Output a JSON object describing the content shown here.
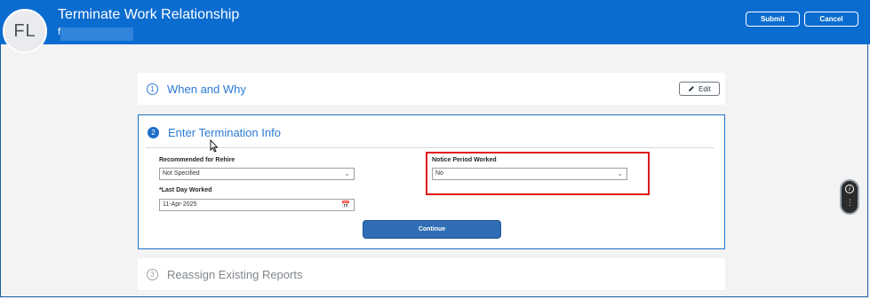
{
  "header": {
    "avatar_initials": "FL",
    "title": "Terminate Work Relationship",
    "subtitle": "f",
    "submit_label": "Submit",
    "cancel_label": "Cancel",
    "bg_color": "#0b6cd0"
  },
  "steps": [
    {
      "number": "1",
      "title": "When and Why",
      "edit_label": "Edit"
    },
    {
      "number": "2",
      "title": "Enter Termination Info"
    },
    {
      "number": "3",
      "title": "Reassign Existing Reports"
    }
  ],
  "form": {
    "rehire_label": "Recommended for Rehire",
    "rehire_value": "Not Specified",
    "last_day_required": "*",
    "last_day_label": "Last Day Worked",
    "last_day_value": "11-Apr-2025",
    "notice_label": "Notice Period Worked",
    "notice_value": "No",
    "continue_label": "Continue"
  },
  "colors": {
    "accent": "#0b6cd0",
    "highlight": "#e01818",
    "button": "#2f6db5"
  }
}
